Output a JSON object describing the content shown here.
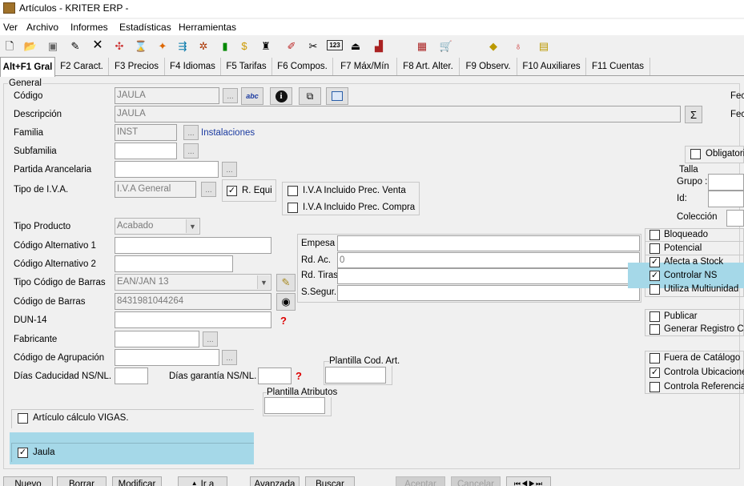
{
  "window": {
    "title": "Artículos - KRITER ERP -"
  },
  "menu": [
    "Ver",
    "Archivo",
    "Informes",
    "Estadísticas",
    "Herramientas"
  ],
  "toolbar": {
    "icons": [
      "new-document-icon",
      "open-folder-icon",
      "save-icon",
      "edit-icon",
      "delete-icon",
      "tool1-icon",
      "tool2-icon",
      "tool3-icon",
      "tool4-icon",
      "tool5-icon",
      "tool6-icon",
      "money-icon",
      "tool7-icon",
      "tool8-icon",
      "tool9-icon",
      "123-icon",
      "tool10-icon",
      "bar-chart-icon",
      "calculator-icon",
      "cart-icon",
      "tool11-icon",
      "money-bag-icon",
      "tool12-icon"
    ],
    "label_123": "123"
  },
  "tabs": [
    "Alt+F1 Gral",
    "F2 Caract.",
    "F3 Precios",
    "F4 Idiomas",
    "F5 Tarifas",
    "F6 Compos.",
    "F7 Máx/Mín",
    "F8 Art. Alter.",
    "F9 Observ.",
    "F10 Auxiliares",
    "F11 Cuentas"
  ],
  "general": {
    "group_label": "General",
    "codigo_label": "Código",
    "codigo_value": "JAULA",
    "descripcion_label": "Descripción",
    "descripcion_value": "JAULA",
    "familia_label": "Familia",
    "familia_value": "INST",
    "familia_desc": "Instalaciones",
    "subfamilia_label": "Subfamilia",
    "partida_label": "Partida Arancelaria",
    "iva_label": "Tipo de I.V.A.",
    "iva_value": "I.V.A General",
    "requi_label": "R. Equi",
    "iva_venta_label": "I.V.A Incluido Prec. Venta",
    "iva_compra_label": "I.V.A Incluido Prec. Compra",
    "tipo_producto_label": "Tipo Producto",
    "tipo_producto_value": "Acabado",
    "cod_alt1_label": "Código Alternativo 1",
    "cod_alt2_label": "Código Alternativo 2",
    "tipo_barras_label": "Tipo Código de Barras",
    "tipo_barras_value": "EAN/JAN 13",
    "barras_label": "Código de Barras",
    "barras_value": "8431981044264",
    "dun_label": "DUN-14",
    "fabricante_label": "Fabricante",
    "agrupacion_label": "Código de Agrupación",
    "dias_cad_label": "Días Caducidad NS/NL.",
    "dias_gar_label": "Días garantía NS/NL.",
    "plantilla_cod_label": "Plantilla Cod. Art.",
    "plantilla_attr_label": "Plantilla Atributos",
    "vigas_label": "Artículo cálculo VIGAS.",
    "jaula_label": "Jaula",
    "abc_label": "abc"
  },
  "empresa": {
    "empresa_label": "Empesa",
    "rdac_label": "Rd. Ac.",
    "rdac_value": "0",
    "rdtiras_label": "Rd. Tiras",
    "ssegur_label": "S.Segur."
  },
  "right": {
    "fec1": "Fec",
    "fec2": "Fec",
    "obligatorio": "Obligatorio",
    "talla": "Talla",
    "grupo": "Grupo :",
    "id": "Id:",
    "coleccion": "Colección",
    "bloqueado": "Bloqueado",
    "potencial": "Potencial",
    "afecta_stock": "Afecta a Stock",
    "controlar_ns": "Controlar NS",
    "multiunidad": "Utiliza Multiunidad",
    "publicar": "Publicar",
    "generar_registro": "Generar Registro Com",
    "fuera_catalogo": "Fuera de Catálogo",
    "controla_ubic": "Controla Ubicaciones",
    "controla_ref": "Controla Referencia"
  },
  "buttons": {
    "nuevo": "Nuevo",
    "borrar": "Borrar",
    "modificar": "Modificar",
    "ir_a": "Ir a",
    "avanzada": "Avanzada",
    "buscar": "Buscar",
    "aceptar": "Aceptar",
    "cancelar": "Cancelar"
  },
  "colors": {
    "highlight": "#a5d8e8",
    "link": "#1a3aa0"
  }
}
